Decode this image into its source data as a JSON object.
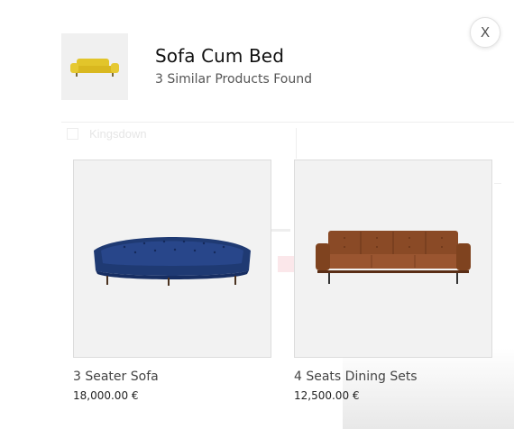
{
  "modal": {
    "title": "Sofa Cum Bed",
    "subtitle": "3 Similar Products Found",
    "close_label": "X"
  },
  "background": {
    "ghost_label": "Kingsdown"
  },
  "products": [
    {
      "name": "3 Seater Sofa",
      "price": "18,000.00 €",
      "image": "blue-velvet-curved-sofa"
    },
    {
      "name": "4 Seats Dining Sets",
      "price": "12,500.00 €",
      "image": "brown-leather-sofa"
    }
  ],
  "colors": {
    "thumb_sofa": "#e2c52a",
    "blue_sofa": "#1f3a73",
    "brown_sofa": "#8a4a26"
  }
}
